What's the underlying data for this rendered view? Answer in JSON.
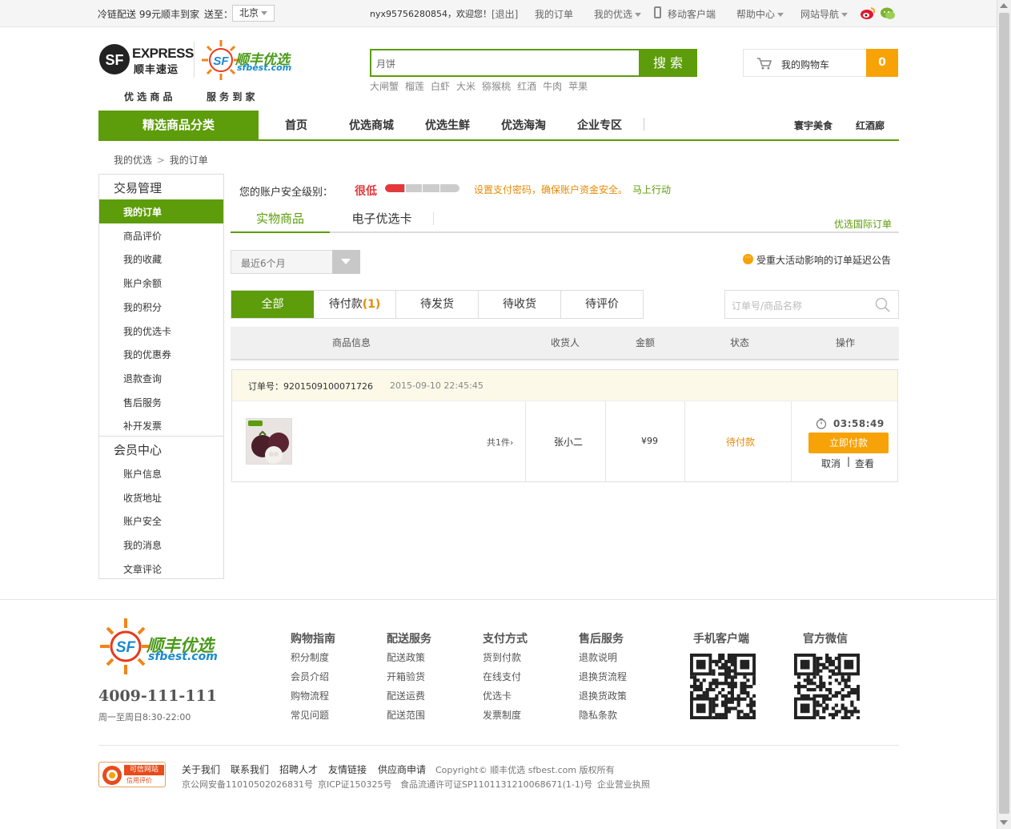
{
  "topbar": {
    "promo": "冷链配送 99元顺丰到家",
    "ship_to_label": "送至：",
    "ship_to_city": "北京",
    "user_greeting": "nyx95756280854，欢迎您！",
    "logout": "[退出]",
    "my_orders": "我的订单",
    "my_sfbest": "我的优选",
    "mobile": "移动客户端",
    "help": "帮助中心",
    "site_nav": "网站导航"
  },
  "header": {
    "express_logo_text": "EXPRESS",
    "express_logo_sub": "顺丰速运",
    "sfbest_logo_cn": "顺丰优选",
    "sfbest_logo_en": "sfbest.com",
    "slogan_left": "优 选 商 品",
    "slogan_right": "服 务 到 家",
    "search_placeholder": "月饼",
    "search_button": "搜 索",
    "hot_words": [
      "大闸蟹",
      "榴莲",
      "白虾",
      "大米",
      "猕猴桃",
      "红酒",
      "牛肉",
      "苹果"
    ],
    "cart_label": "我的购物车",
    "cart_count": "0"
  },
  "nav": {
    "category": "精选商品分类",
    "items": [
      "首页",
      "优选商城",
      "优选生鲜",
      "优选海淘",
      "企业专区"
    ],
    "right_items": [
      "寰宇美食",
      "红酒廊"
    ]
  },
  "breadcrumb": {
    "root": "我的优选",
    "sep": ">",
    "current": "我的订单"
  },
  "sidebar": {
    "group1_title": "交易管理",
    "group1_items": [
      "我的订单",
      "商品评价",
      "我的收藏",
      "账户余额",
      "我的积分",
      "我的优选卡",
      "我的优惠券",
      "退款查询",
      "售后服务",
      "补开发票"
    ],
    "group2_title": "会员中心",
    "group2_items": [
      "账户信息",
      "收货地址",
      "账户安全",
      "我的消息",
      "文章评论"
    ]
  },
  "security": {
    "label": "您的账户安全级别：",
    "level": "很低",
    "level_fraction": 0.2,
    "tip": "设置支付密码，确保账户资金安全。",
    "action": "马上行动"
  },
  "main_tabs": {
    "physical": "实物商品",
    "ecard": "电子优选卡",
    "intl_orders": "优选国际订单"
  },
  "filter": {
    "range": "最近6个月",
    "notice": "受重大活动影响的订单延迟公告"
  },
  "status_tabs": {
    "all": "全部",
    "pending_pay": "待付款",
    "pending_pay_count": "(1)",
    "pending_ship": "待发货",
    "pending_receive": "待收货",
    "pending_review": "待评价",
    "search_placeholder": "订单号/商品名称"
  },
  "table_headers": [
    "商品信息",
    "收货人",
    "金额",
    "状态",
    "操作"
  ],
  "order": {
    "number_label": "订单号：",
    "number": "9201509100071726",
    "datetime": "2015-09-10 22:45:45",
    "item_count": "共1件",
    "recipient": "张小二",
    "amount": "¥99",
    "status": "待付款",
    "countdown": "03:58:49",
    "pay_button": "立即付款",
    "cancel": "取消",
    "sep": "|",
    "view": "查看"
  },
  "footer": {
    "logo_cn": "顺丰优选",
    "logo_en": "sfbest.com",
    "phone": "4009-111-111",
    "hours": "周一至周日8:30-22:00",
    "columns": [
      {
        "title": "购物指南",
        "links": [
          "积分制度",
          "会员介绍",
          "购物流程",
          "常见问题"
        ]
      },
      {
        "title": "配送服务",
        "links": [
          "配送政策",
          "开箱验货",
          "配送运费",
          "配送范围"
        ]
      },
      {
        "title": "支付方式",
        "links": [
          "货到付款",
          "在线支付",
          "优选卡",
          "发票制度"
        ]
      },
      {
        "title": "售后服务",
        "links": [
          "退款说明",
          "退换货流程",
          "退换货政策",
          "隐私条款"
        ]
      }
    ],
    "mobile_client": "手机客户端",
    "wechat": "官方微信",
    "bottom_links": [
      "关于我们",
      "联系我们",
      "招聘人才",
      "友情链接",
      "供应商申请"
    ],
    "copyright": "Copyright© 顺丰优选 sfbest.com 版权所有",
    "icp_line": [
      "京公网安备11010502026831号",
      "京ICP证150325号",
      "食品流通许可证SP1101131210068671(1-1)号",
      "企业营业执照"
    ],
    "credit_badge": "可信网站",
    "credit_badge_sub": "信用评价"
  }
}
